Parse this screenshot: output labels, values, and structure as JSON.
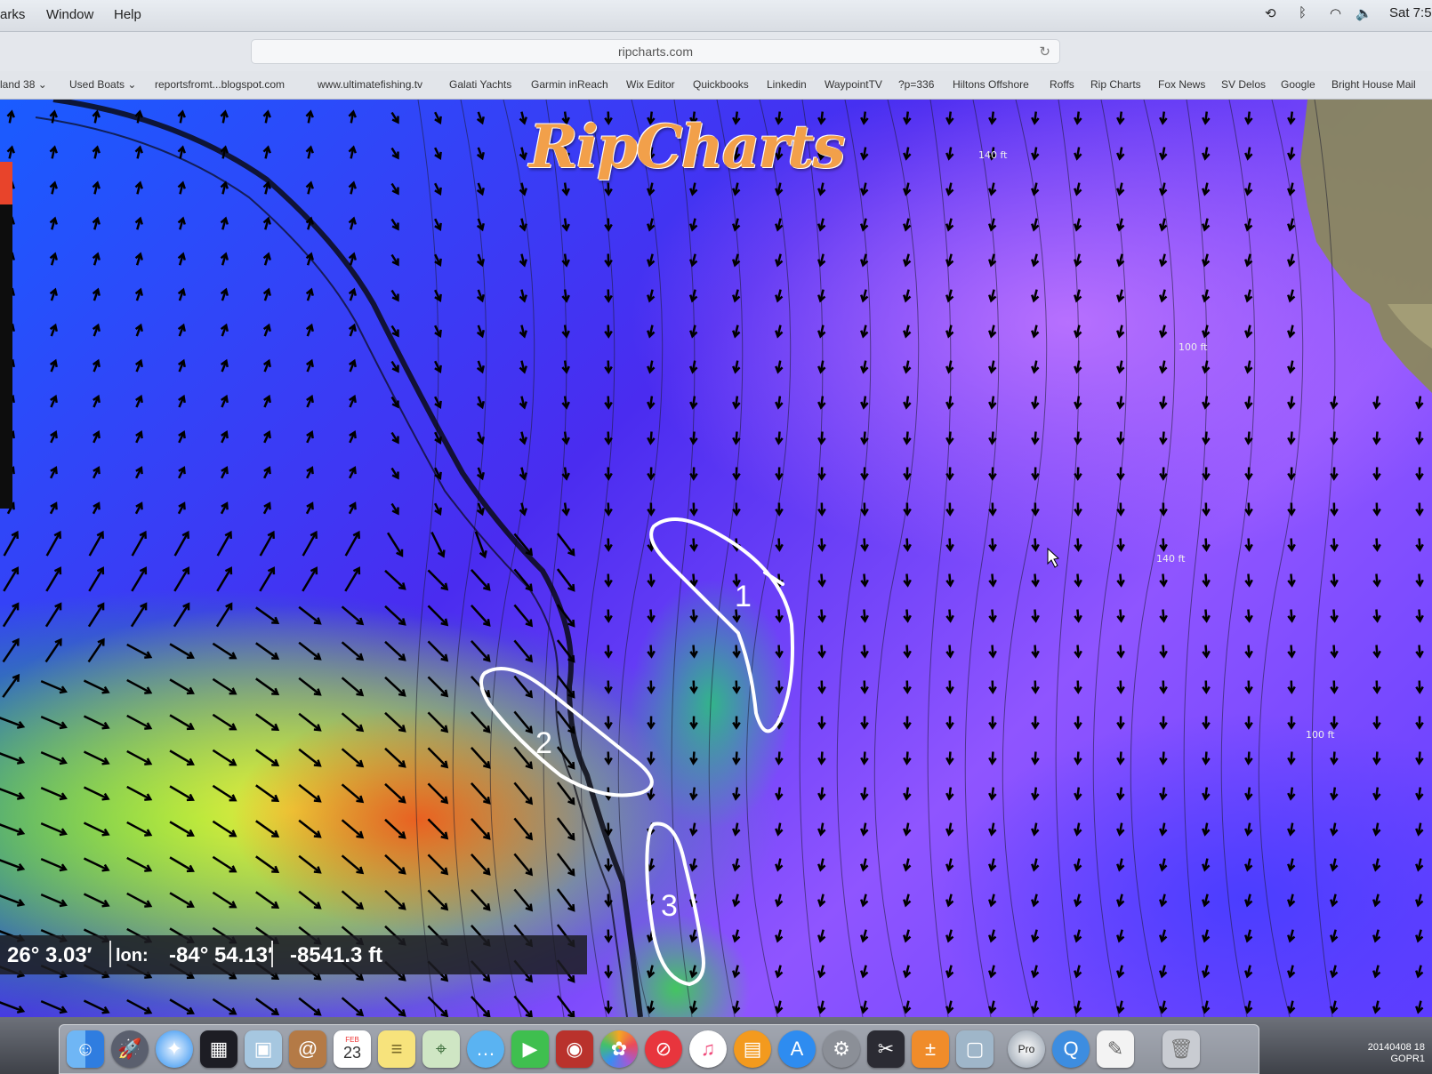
{
  "menubar": {
    "items": [
      "arks",
      "Window",
      "Help"
    ],
    "clock": "Sat 7:5"
  },
  "browser": {
    "url": "ripcharts.com",
    "bookmarks": [
      "land 38 ⌄",
      "Used Boats ⌄",
      "reportsfromt...blogspot.com",
      "www.ultimatefishing.tv",
      "Galati Yachts",
      "Garmin inReach",
      "Wix Editor",
      "Quickbooks",
      "Linkedin",
      "WaypointTV",
      "?p=336",
      "Hiltons Offshore",
      "Roffs",
      "Rip Charts",
      "Fox News",
      "SV Delos",
      "Google",
      "Bright House Mail"
    ]
  },
  "map": {
    "logo": "RipCharts",
    "depth_labels": [
      "140 ft",
      "100 ft",
      "140 ft",
      "100 ft"
    ],
    "annotations": [
      "1",
      "2",
      "3"
    ],
    "readout": {
      "lat": "26° 3.03′",
      "lon_label": "lon:",
      "lon": "-84° 54.13′",
      "depth": "-8541.3 ft"
    },
    "colors": {
      "deep": "#1a5cff",
      "violet": "#8f55ff",
      "green": "#28dc3c",
      "yellow": "#f8ee3c",
      "orange": "#ec5a1e",
      "annotation": "#ffffff"
    }
  },
  "dock": {
    "icons": [
      "finder-icon",
      "launchpad-icon",
      "safari-icon",
      "mission-control-icon",
      "preview-icon",
      "contacts-icon",
      "calendar-icon",
      "notes-icon",
      "maps-icon",
      "messages-icon",
      "facetime-icon",
      "photo-booth-icon",
      "photos-icon",
      "news-icon",
      "music-icon",
      "books-icon",
      "app-store-icon",
      "system-preferences-icon",
      "final-cut-icon",
      "calculator-icon",
      "image-capture-icon",
      "google-earth-pro-icon",
      "quicktime-icon",
      "textedit-icon",
      "trash-icon"
    ],
    "calendar_day": "23",
    "calendar_month": "FEB"
  },
  "camera_stamp": {
    "line1": "20140408 18",
    "line2": "GOPR1"
  }
}
